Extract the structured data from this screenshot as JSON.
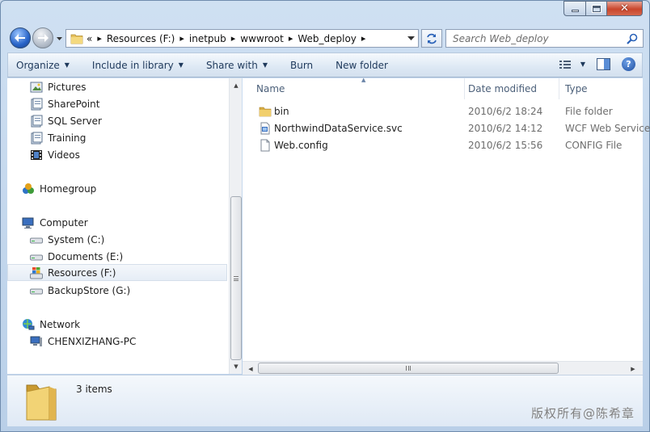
{
  "window": {
    "controls": {
      "minimize": "minimize",
      "maximize": "maximize",
      "close": "✕"
    }
  },
  "address": {
    "overflow": "«",
    "crumbs": [
      "Resources (F:)",
      "inetpub",
      "wwwroot",
      "Web_deploy"
    ]
  },
  "search": {
    "placeholder": "Search Web_deploy"
  },
  "toolbar": {
    "organize": "Organize",
    "include_in_library": "Include in library",
    "share_with": "Share with",
    "burn": "Burn",
    "new_folder": "New folder",
    "help": "?"
  },
  "sidebar": {
    "items": [
      {
        "label": "Pictures",
        "icon": "pictures-library-icon"
      },
      {
        "label": "SharePoint",
        "icon": "library-icon"
      },
      {
        "label": "SQL Server",
        "icon": "library-icon"
      },
      {
        "label": "Training",
        "icon": "library-icon"
      },
      {
        "label": "Videos",
        "icon": "videos-library-icon"
      },
      {
        "label": "Homegroup",
        "icon": "homegroup-icon"
      },
      {
        "label": "Computer",
        "icon": "computer-icon"
      },
      {
        "label": "System (C:)",
        "icon": "drive-icon"
      },
      {
        "label": "Documents (E:)",
        "icon": "drive-icon"
      },
      {
        "label": "Resources (F:)",
        "icon": "windows-drive-icon",
        "selected": true
      },
      {
        "label": "BackupStore (G:)",
        "icon": "drive-icon"
      },
      {
        "label": "Network",
        "icon": "network-icon"
      },
      {
        "label": "CHENXIZHANG-PC",
        "icon": "pc-icon"
      }
    ]
  },
  "columns": {
    "name": "Name",
    "date_modified": "Date modified",
    "type": "Type"
  },
  "files": [
    {
      "name": "bin",
      "date": "2010/6/2 18:24",
      "type": "File folder",
      "icon": "folder-icon"
    },
    {
      "name": "NorthwindDataService.svc",
      "date": "2010/6/2 14:12",
      "type": "WCF Web Service",
      "icon": "svc-file-icon"
    },
    {
      "name": "Web.config",
      "date": "2010/6/2 15:56",
      "type": "CONFIG File",
      "icon": "config-file-icon"
    }
  ],
  "details": {
    "count": "3 items"
  },
  "watermark": "版权所有@陈希章",
  "colors": {
    "accent": "#1e395b",
    "selection": "#e6edf6",
    "frame": "#b9cfe8"
  }
}
